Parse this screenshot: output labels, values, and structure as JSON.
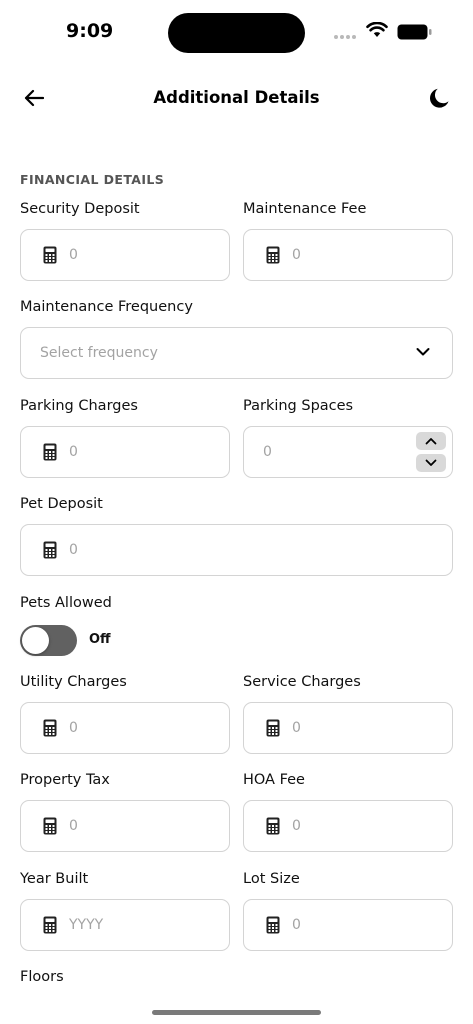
{
  "status_bar": {
    "time": "9:09"
  },
  "header": {
    "title": "Additional Details"
  },
  "section": {
    "title": "FINANCIAL DETAILS"
  },
  "fields": {
    "security_deposit": {
      "label": "Security Deposit",
      "value": "0"
    },
    "maintenance_fee": {
      "label": "Maintenance Fee",
      "value": "0"
    },
    "maintenance_frequency": {
      "label": "Maintenance Frequency",
      "placeholder": "Select frequency"
    },
    "parking_charges": {
      "label": "Parking Charges",
      "value": "0"
    },
    "parking_spaces": {
      "label": "Parking Spaces",
      "value": "0"
    },
    "pet_deposit": {
      "label": "Pet Deposit",
      "value": "0"
    },
    "pets_allowed": {
      "label": "Pets Allowed",
      "state": "Off"
    },
    "utility_charges": {
      "label": "Utility Charges",
      "value": "0"
    },
    "service_charges": {
      "label": "Service Charges",
      "value": "0"
    },
    "property_tax": {
      "label": "Property Tax",
      "value": "0"
    },
    "hoa_fee": {
      "label": "HOA Fee",
      "value": "0"
    },
    "year_built": {
      "label": "Year Built",
      "placeholder": "YYYY"
    },
    "lot_size": {
      "label": "Lot Size",
      "value": "0"
    },
    "floors": {
      "label": "Floors"
    }
  },
  "icons": {
    "back": "arrow-left-icon",
    "theme": "moon-icon",
    "currency": "calculator-icon",
    "dropdown": "chevron-down-icon",
    "step_up": "chevron-up-icon",
    "step_down": "chevron-down-icon"
  },
  "colors": {
    "toggle_track": "#616161",
    "field_border": "#d4d4d4",
    "placeholder": "#a3a3a3"
  }
}
